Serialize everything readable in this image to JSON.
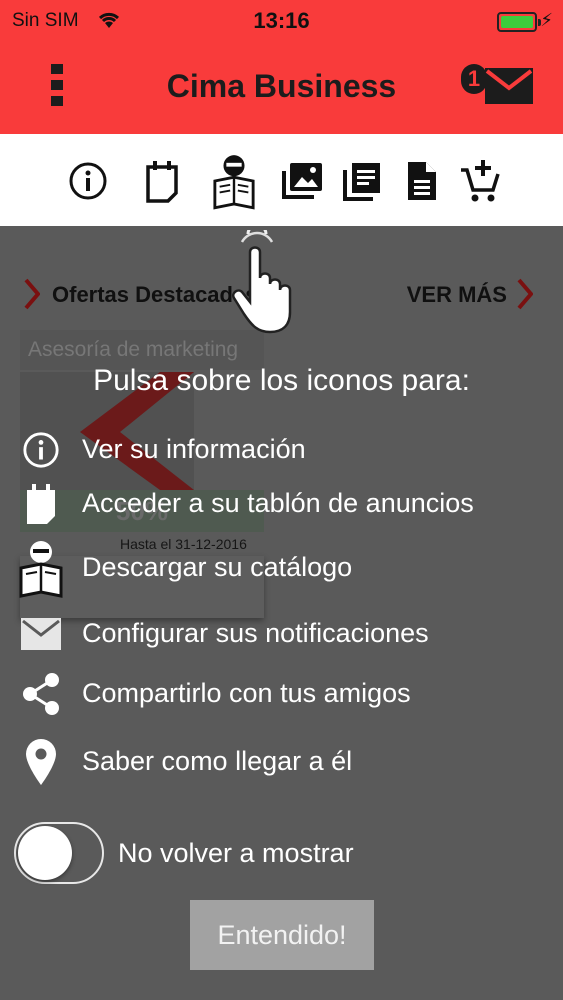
{
  "status": {
    "carrier": "Sin SIM",
    "time": "13:16",
    "battery_level": 1.0
  },
  "header": {
    "title": "Cima Business",
    "mail_badge": "1",
    "colors": {
      "brand": "#f93b3b"
    }
  },
  "toolbar": {
    "icons": [
      "info-icon",
      "notepad-icon",
      "reader-icon",
      "photos-icon",
      "library-icon",
      "document-icon",
      "add-to-cart-icon"
    ]
  },
  "background": {
    "section_title": "Ofertas Destacadas",
    "see_more": "VER MÁS",
    "card_tag": "Asesoría de marketing",
    "card_discount": "50%",
    "card_date": "Hasta el 31-12-2016"
  },
  "overlay": {
    "heading": "Pulsa sobre los iconos para:",
    "items": [
      {
        "icon": "info-icon",
        "text": "Ver su información"
      },
      {
        "icon": "notepad-icon",
        "text": "Acceder a su tablón de anuncios"
      },
      {
        "icon": "reader-icon",
        "text": "Descargar su catálogo"
      },
      {
        "icon": "mail-icon",
        "text": "Configurar sus notificaciones"
      },
      {
        "icon": "share-icon",
        "text": "Compartirlo con tus amigos"
      },
      {
        "icon": "location-pin-icon",
        "text": "Saber como llegar a él"
      }
    ],
    "toggle_label": "No volver a mostrar",
    "toggle_on": false,
    "button": "Entendido!"
  }
}
